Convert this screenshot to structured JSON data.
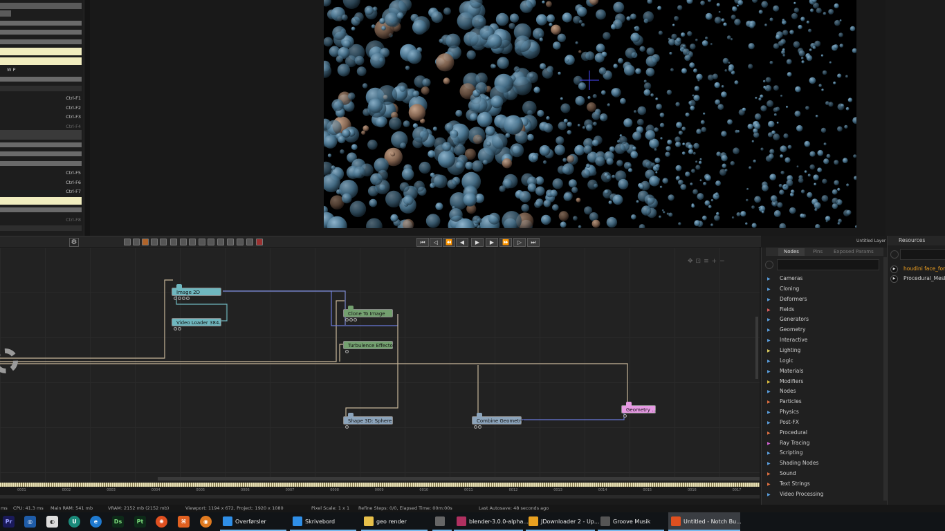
{
  "left_menu": {
    "wp_label": "W   P",
    "shortcuts": [
      "Ctrl-F1",
      "Ctrl-F2",
      "Ctrl-F3",
      "Ctrl-F4",
      "Ctrl-F5",
      "Ctrl-F6",
      "Ctrl-F7",
      "Ctrl-F8"
    ]
  },
  "layer_label": "Untitled Layer",
  "node_graph": {
    "nodes": {
      "image_2d": "Image 2D",
      "video_loader": "Video Loader 384...",
      "clone_to_image": "Clone To Image",
      "turbulence_effector": "Turbulence Effector",
      "shape_3d": "Shape 3D: Sphere",
      "combine_geometry": "Combine Geometry",
      "geometry": "Geometry ..."
    }
  },
  "timeline": {
    "ticks": [
      "0001",
      "0002",
      "0003",
      "0004",
      "0005",
      "0006",
      "0007",
      "0008",
      "0009",
      "0010",
      "0011",
      "0012",
      "0013",
      "0014",
      "0015",
      "0016",
      "0017"
    ]
  },
  "nodes_panel": {
    "tabs": [
      "Nodes",
      "Pins",
      "Exposed Params"
    ],
    "categories": [
      {
        "label": "Cameras",
        "color": "#5aa0e0"
      },
      {
        "label": "Cloning",
        "color": "#5aa0e0"
      },
      {
        "label": "Deformers",
        "color": "#5aa0e0"
      },
      {
        "label": "Fields",
        "color": "#e06060"
      },
      {
        "label": "Generators",
        "color": "#5aa0e0"
      },
      {
        "label": "Geometry",
        "color": "#5aa0e0"
      },
      {
        "label": "Interactive",
        "color": "#5aa0e0"
      },
      {
        "label": "Lighting",
        "color": "#e0d060"
      },
      {
        "label": "Logic",
        "color": "#5aa0e0"
      },
      {
        "label": "Materials",
        "color": "#5aa0e0"
      },
      {
        "label": "Modifiers",
        "color": "#e0c040"
      },
      {
        "label": "Nodes",
        "color": "#5aa0e0"
      },
      {
        "label": "Particles",
        "color": "#e07040"
      },
      {
        "label": "Physics",
        "color": "#5aa0e0"
      },
      {
        "label": "Post-FX",
        "color": "#5aa0e0"
      },
      {
        "label": "Procedural",
        "color": "#e07040"
      },
      {
        "label": "Ray Tracing",
        "color": "#d060d0"
      },
      {
        "label": "Scripting",
        "color": "#5aa0e0"
      },
      {
        "label": "Shading Nodes",
        "color": "#5aa0e0"
      },
      {
        "label": "Sound",
        "color": "#e07040"
      },
      {
        "label": "Text Strings",
        "color": "#e07040"
      },
      {
        "label": "Video Processing",
        "color": "#5aa0e0"
      }
    ]
  },
  "resources_panel": {
    "title": "Resources",
    "items": [
      {
        "label": "houdini face_for",
        "color": "#f0a020"
      },
      {
        "label": "Procedural_Mesh",
        "color": "#d0d0d0"
      }
    ]
  },
  "status_bar": {
    "frame": "ms",
    "cpu": "CPU: 41.3 ms",
    "ram": "Main RAM: 541 mb",
    "vram": "VRAM: 2152 mb (2152 mb)",
    "viewport": "Viewport: 1194 x 672, Project: 1920 x 1080",
    "pixel_scale": "Pixel Scale: 1 x 1",
    "refine": "Refine Steps: 0/0, Elapsed Time: 00m:00s",
    "autosave": "Last Autosave: 48 seconds ago"
  },
  "taskbar": {
    "tasks": [
      {
        "label": "Overførsler",
        "color": "#2f8fe8"
      },
      {
        "label": "Skrivebord",
        "color": "#2f8fe8"
      },
      {
        "label": "geo render",
        "color": "#e8c04a"
      },
      {
        "label": "",
        "color": "#666"
      },
      {
        "label": "blender-3.0.0-alpha...",
        "color": "#b03060"
      },
      {
        "label": "JDownloader 2 - Up...",
        "color": "#e8a020"
      },
      {
        "label": "Groove Musik",
        "color": "#555"
      },
      {
        "label": "Untitled - Notch Bu...",
        "color": "#e05020"
      }
    ]
  }
}
